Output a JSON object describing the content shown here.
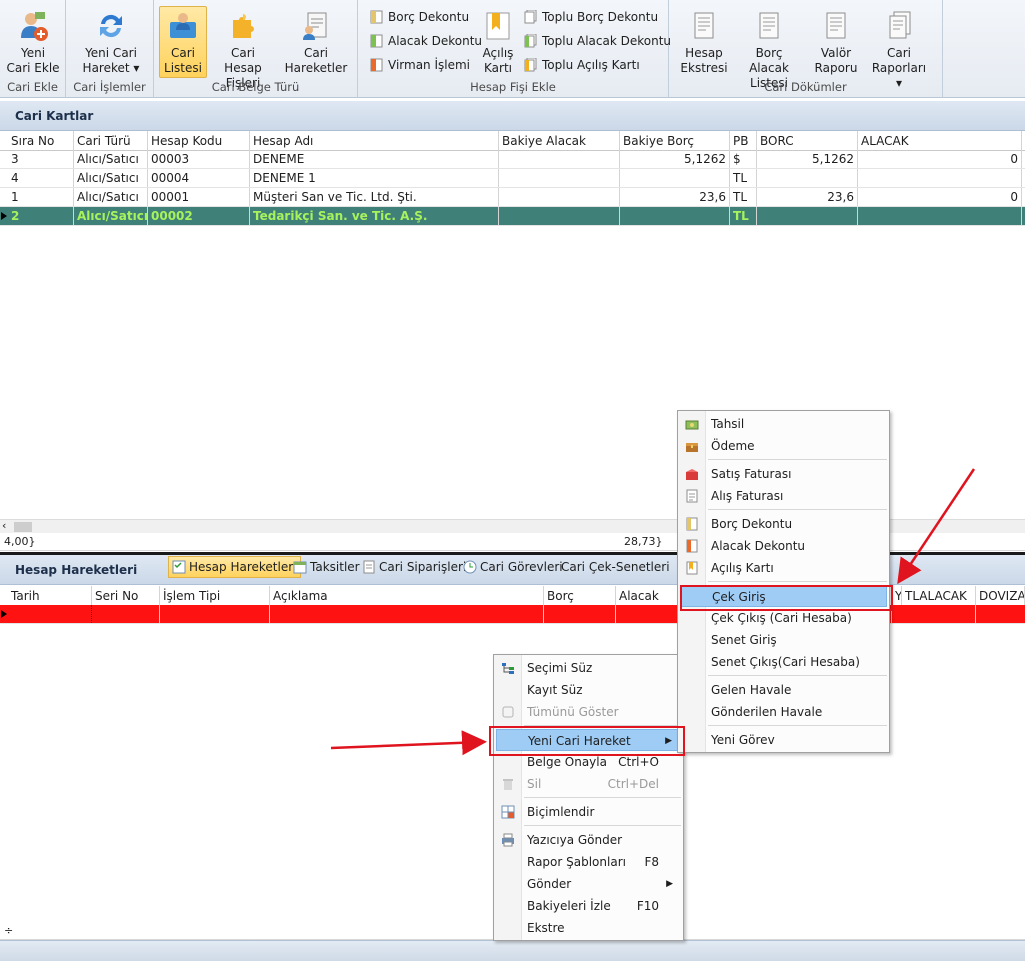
{
  "ribbon": {
    "groups": [
      {
        "label": "Cari Ekle"
      },
      {
        "label": "Cari İşlemler"
      },
      {
        "label": "Cari Belge Türü"
      },
      {
        "label": "Hesap Fişi Ekle"
      },
      {
        "label": "Cari Dökümler"
      }
    ],
    "buttons": {
      "yeni_cari_ekle": [
        "Yeni",
        "Cari Ekle"
      ],
      "yeni_cari_hareket": [
        "Yeni Cari",
        "Hareket ▾"
      ],
      "cari_listesi": [
        "Cari",
        "Listesi"
      ],
      "cari_hesap_fisleri": [
        "Cari Hesap",
        "Fişleri"
      ],
      "cari_hareketler": [
        "Cari",
        "Hareketler"
      ],
      "acilis_karti": [
        "Açılış",
        "Kartı"
      ],
      "hesap_ekstresi": [
        "Hesap",
        "Ekstresi"
      ],
      "borc_alacak_listesi": [
        "Borç Alacak",
        "Listesi"
      ],
      "valor_raporu": [
        "Valör",
        "Raporu"
      ],
      "cari_raporlari": [
        "Cari",
        "Raporları ▾"
      ]
    },
    "small_buttons": {
      "borc_dekontu": "Borç Dekontu",
      "alacak_dekontu": "Alacak Dekontu",
      "virman_islemi": "Virman İşlemi",
      "toplu_borc_dekontu": "Toplu Borç Dekontu",
      "toplu_alacak_dekontu": "Toplu Alacak Dekontu",
      "toplu_acilis_karti": "Toplu Açılış Kartı"
    }
  },
  "cari_kartlar": {
    "title": "Cari Kartlar",
    "columns": [
      "Sıra No",
      "Cari Türü",
      "Hesap Kodu",
      "Hesap Adı",
      "Bakiye Alacak",
      "Bakiye Borç",
      "PB",
      "BORC",
      "ALACAK"
    ],
    "rows": [
      [
        "3",
        "Alıcı/Satıcı",
        "00003",
        "DENEME",
        "",
        "5,1262",
        "$",
        "5,1262",
        "0"
      ],
      [
        "4",
        "Alıcı/Satıcı",
        "00004",
        "DENEME 1",
        "",
        "",
        "TL",
        "",
        ""
      ],
      [
        "1",
        "Alıcı/Satıcı",
        "00001",
        "Müşteri San ve Tic. Ltd. Şti.",
        "",
        "23,6",
        "TL",
        "23,6",
        "0"
      ],
      [
        "2",
        "Alıcı/Satıcı",
        "00002",
        "Tedarikçi San. ve Tic. A.Ş.",
        "",
        "",
        "TL",
        "",
        ""
      ]
    ],
    "footer_left": "4,00}",
    "footer_borc": "28,73}"
  },
  "hesap_hareketleri": {
    "title": "Hesap Hareketleri",
    "tabs": [
      "Hesap Hareketleri",
      "Taksitler",
      "Cari Siparişleri",
      "Cari Görevleri",
      "Cari Çek-Senetleri"
    ],
    "columns": [
      "Tarih",
      "Seri No",
      "İşlem Tipi",
      "Açıklama",
      "Borç",
      "Alacak",
      "Y",
      "TLALACAK",
      "DOVIZAL"
    ]
  },
  "context_menu": {
    "items": {
      "secimi_suz": "Seçimi Süz",
      "kayit_suz": "Kayıt Süz",
      "tumunu_goster": "Tümünü Göster",
      "yeni_cari_hareket": "Yeni Cari Hareket",
      "belge_onayla": "Belge Onayla",
      "belge_onayla_sc": "Ctrl+O",
      "sil": "Sil",
      "sil_sc": "Ctrl+Del",
      "bicimlendir": "Biçimlendir",
      "yaziciya_gonder": "Yazıcıya Gönder",
      "rapor_sablonlari": "Rapor Şablonları",
      "rapor_sablonlari_sc": "F8",
      "gonder": "Gönder",
      "bakiyeleri_izle": "Bakiyeleri İzle",
      "bakiyeleri_izle_sc": "F10",
      "ekstre": "Ekstre"
    }
  },
  "submenu": {
    "items": {
      "tahsil": "Tahsil",
      "odeme": "Ödeme",
      "satis_faturasi": "Satış Faturası",
      "alis_faturasi": "Alış Faturası",
      "borc_dekontu": "Borç Dekontu",
      "alacak_dekontu": "Alacak Dekontu",
      "acilis_karti": "Açılış Kartı",
      "cek_giris": "Çek Giriş",
      "cek_cikis": "Çek Çıkış (Cari Hesaba)",
      "senet_giris": "Senet Giriş",
      "senet_cikis": "Senet Çıkış(Cari Hesaba)",
      "gelen_havale": "Gelen Havale",
      "gonderilen_havale": "Gönderilen Havale",
      "yeni_gorev": "Yeni Görev"
    }
  },
  "colors": {
    "selected_row_bg": "#3f8079",
    "selected_row_fg": "#a7f25d",
    "red_row": "#ff1212",
    "highlight_box": "#e0141e"
  }
}
